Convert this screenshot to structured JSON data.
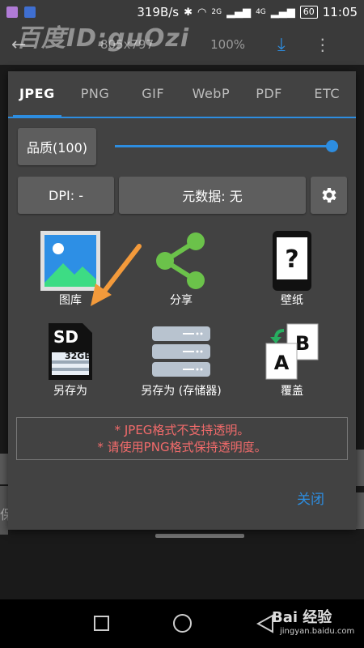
{
  "status_bar": {
    "speed": "319B/s",
    "network_2g": "2G",
    "network_4g": "4G",
    "battery": "60",
    "time": "11:05"
  },
  "background_app": {
    "size_text": "805x797",
    "zoom_text": "100%",
    "bg_left_text": "保"
  },
  "watermark": {
    "top": "百度ID:guOzi",
    "bottom_brand": "Bai 经验",
    "bottom_url": "jingyan.baidu.com"
  },
  "dialog": {
    "tabs": [
      {
        "label": "JPEG",
        "active": true
      },
      {
        "label": "PNG",
        "active": false
      },
      {
        "label": "GIF",
        "active": false
      },
      {
        "label": "WebP",
        "active": false
      },
      {
        "label": "PDF",
        "active": false
      },
      {
        "label": "ETC",
        "active": false
      }
    ],
    "quality_label": "品质(100)",
    "quality_value": 1.0,
    "dpi_label": "DPI: -",
    "metadata_label": "元数据: 无",
    "actions": [
      {
        "label": "图库",
        "icon": "gallery-icon"
      },
      {
        "label": "分享",
        "icon": "share-icon"
      },
      {
        "label": "壁纸",
        "icon": "wallpaper-phone-icon"
      },
      {
        "label": "另存为",
        "icon": "sd-card-icon",
        "sd_text": "SD",
        "sd_cap": "32GB"
      },
      {
        "label": "另存为 (存储器)",
        "icon": "storage-server-icon"
      },
      {
        "label": "覆盖",
        "icon": "overwrite-ab-icon",
        "a_text": "A",
        "b_text": "B"
      }
    ],
    "warning_lines": [
      "* JPEG格式不支持透明。",
      "* 请使用PNG格式保持透明度。"
    ],
    "close_label": "关闭"
  },
  "colors": {
    "accent": "#2d8de0",
    "warning": "#f26b6b",
    "dialog_bg": "#424242",
    "arrow": "#f39a3b"
  }
}
